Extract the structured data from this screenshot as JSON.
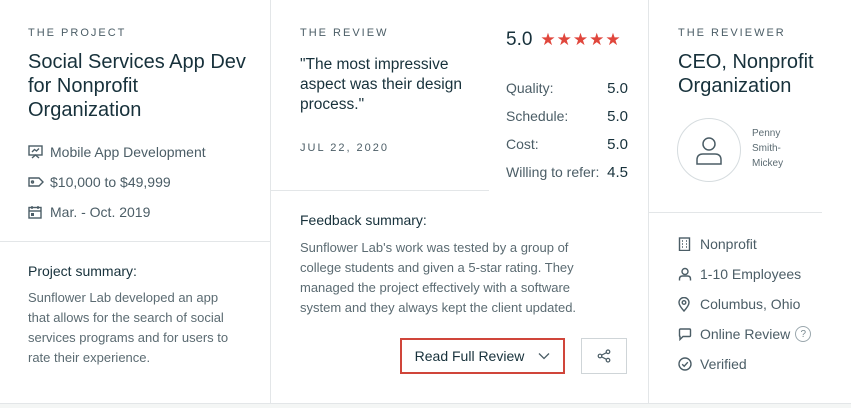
{
  "project": {
    "eyebrow": "THE PROJECT",
    "title_line1": "Social Services App Dev",
    "title_line2": "for Nonprofit",
    "title_line3": "Organization",
    "service": "Mobile App Development",
    "budget": "$10,000 to $49,999",
    "timeline": "Mar. - Oct. 2019",
    "summary_label": "Project summary:",
    "summary_lines": [
      "Sunflower Lab developed an app",
      "that allows for the search of social",
      "services programs and for users to",
      "rate their experience."
    ]
  },
  "review": {
    "eyebrow": "THE REVIEW",
    "quote_lines": [
      "\"The most impressive",
      "aspect was their design",
      "process.\""
    ],
    "date": "JUL 22, 2020",
    "overall_rating": "5.0",
    "stars": 5,
    "star_color": "#e0463c",
    "scores": [
      {
        "label": "Quality:",
        "value": "5.0"
      },
      {
        "label": "Schedule:",
        "value": "5.0"
      },
      {
        "label": "Cost:",
        "value": "5.0"
      },
      {
        "label": "Willing to refer:",
        "value": "4.5"
      }
    ],
    "feedback_label": "Feedback summary:",
    "feedback_lines": [
      "Sunflower Lab's work was tested by a group of",
      "college students and given a 5-star rating. They",
      "managed the project effectively with a software",
      "system and they always kept the client updated."
    ],
    "read_button": "Read Full Review",
    "button_border_color": "#d0453a"
  },
  "reviewer": {
    "eyebrow": "THE REVIEWER",
    "title_line1": "CEO, Nonprofit",
    "title_line2": "Organization",
    "name_lines": [
      "Penny",
      "Smith-",
      "Mickey"
    ],
    "industry": "Nonprofit",
    "employees": "1-10 Employees",
    "location": "Columbus, Ohio",
    "review_type": "Online Review",
    "help": "?",
    "verified": "Verified"
  }
}
